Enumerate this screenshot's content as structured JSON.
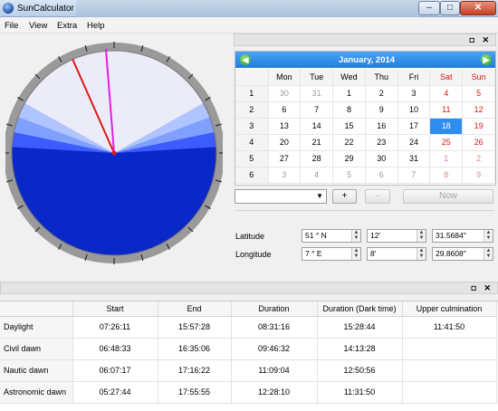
{
  "window": {
    "title": "SunCalculator",
    "controls": {
      "minimize": "–",
      "maximize": "□",
      "close": "✕"
    }
  },
  "menu": [
    "File",
    "View",
    "Extra",
    "Help"
  ],
  "dock_controls": "◘ ✕",
  "colors": {
    "calendar_header": "#1f7ee0",
    "selected_day": "#2f8cf0",
    "weekend": "#d21a1a",
    "daylight": "#0a28c8",
    "sun_now": "#e01818",
    "upper_culmination": "#e020e0"
  },
  "calendar": {
    "title": "January,  2014",
    "prev_icon": "arrow-left-icon",
    "next_icon": "arrow-right-icon",
    "weekdays": [
      "Mon",
      "Tue",
      "Wed",
      "Thu",
      "Fri",
      "Sat",
      "Sun"
    ],
    "weeks": [
      {
        "num": "1",
        "days": [
          "30",
          "31",
          "1",
          "2",
          "3",
          "4",
          "5"
        ]
      },
      {
        "num": "2",
        "days": [
          "6",
          "7",
          "8",
          "9",
          "10",
          "11",
          "12"
        ]
      },
      {
        "num": "3",
        "days": [
          "13",
          "14",
          "15",
          "16",
          "17",
          "18",
          "19"
        ]
      },
      {
        "num": "4",
        "days": [
          "20",
          "21",
          "22",
          "23",
          "24",
          "25",
          "26"
        ]
      },
      {
        "num": "5",
        "days": [
          "27",
          "28",
          "29",
          "30",
          "31",
          "1",
          "2"
        ]
      },
      {
        "num": "6",
        "days": [
          "3",
          "4",
          "5",
          "6",
          "7",
          "8",
          "9"
        ]
      }
    ],
    "selected_day": "18"
  },
  "controls": {
    "combo_value": "",
    "plus": "+",
    "minus": "-",
    "now": "Now"
  },
  "coordinates": {
    "latitude": {
      "label": "Latitude",
      "deg": "51 ° N",
      "min": "12'",
      "sec": "31.5684\""
    },
    "longitude": {
      "label": "Longitude",
      "deg": "7 ° E",
      "min": "8'",
      "sec": "29.8608\""
    }
  },
  "times": {
    "columns": [
      "",
      "Start",
      "End",
      "Duration",
      "Duration (Dark time)",
      "Upper culmination"
    ],
    "rows": [
      {
        "name": "Daylight",
        "start": "07:26:11",
        "end": "15:57:28",
        "duration": "08:31:16",
        "dark": "15:28:44",
        "culmination": "11:41:50"
      },
      {
        "name": "Civil dawn",
        "start": "06:48:33",
        "end": "16:35:06",
        "duration": "09:46:32",
        "dark": "14:13:28",
        "culmination": ""
      },
      {
        "name": "Nautic dawn",
        "start": "06:07:17",
        "end": "17:16:22",
        "duration": "11:09:04",
        "dark": "12:50:56",
        "culmination": ""
      },
      {
        "name": "Astronomic dawn",
        "start": "05:27:44",
        "end": "17:55:55",
        "duration": "12:28:10",
        "dark": "11:31:50",
        "culmination": ""
      }
    ]
  }
}
